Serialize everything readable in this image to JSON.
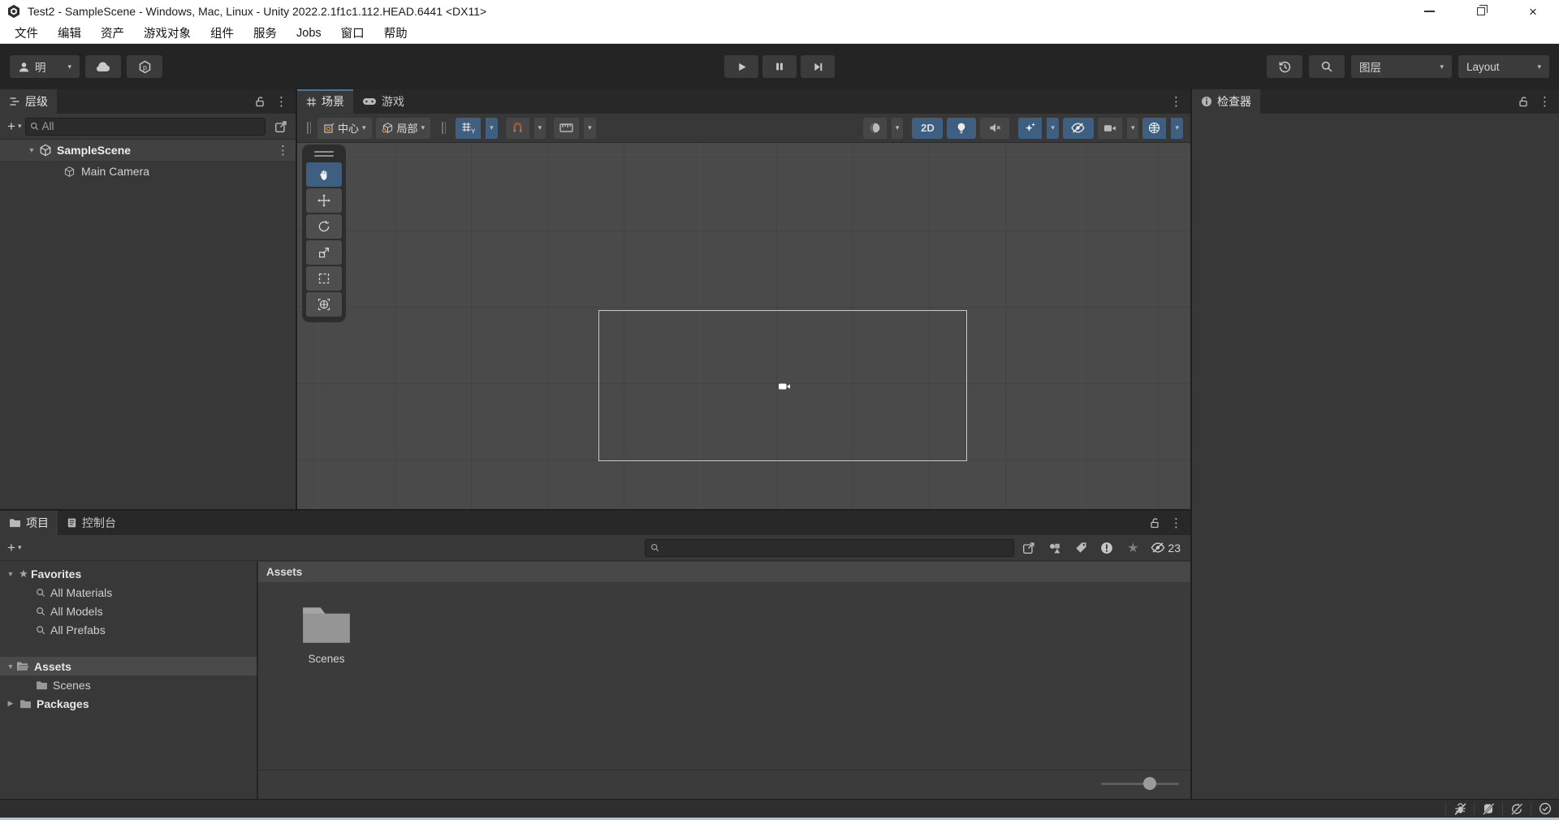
{
  "window": {
    "title": "Test2 - SampleScene - Windows, Mac, Linux - Unity 2022.2.1f1c1.112.HEAD.6441 <DX11>"
  },
  "menu": {
    "items": [
      "文件",
      "编辑",
      "资产",
      "游戏对象",
      "组件",
      "服务",
      "Jobs",
      "窗口",
      "帮助"
    ]
  },
  "toolbar": {
    "account_label": "明",
    "layers_label": "图层",
    "layout_label": "Layout"
  },
  "hierarchy": {
    "tab_label": "层级",
    "search_placeholder": "All",
    "scene_name": "SampleScene",
    "children": [
      "Main Camera"
    ]
  },
  "scene": {
    "tab_scene": "场景",
    "tab_game": "游戏",
    "pivot_label": "中心",
    "space_label": "局部",
    "mode_2d": "2D"
  },
  "project": {
    "tab_project": "项目",
    "tab_console": "控制台",
    "favorites_label": "Favorites",
    "favorites": [
      "All Materials",
      "All Models",
      "All Prefabs"
    ],
    "assets_label": "Assets",
    "scenes_label": "Scenes",
    "packages_label": "Packages",
    "content_header": "Assets",
    "tiles": [
      {
        "name": "Scenes"
      }
    ],
    "hidden_count": "23"
  },
  "inspector": {
    "tab_label": "检查器"
  },
  "glyphs": {
    "plus": "+",
    "caret": "▾",
    "kebab": "⋮",
    "arrow_open": "▼",
    "arrow_closed": "▶",
    "star": "★"
  },
  "colors": {
    "accent_blue": "#4c7299",
    "active_tool_blue": "#3e5f80",
    "scene_background": "#4a4a4a",
    "panel_background": "#383838",
    "chrome_dark": "#282828",
    "gizmo_orange": "#d98a3a"
  }
}
